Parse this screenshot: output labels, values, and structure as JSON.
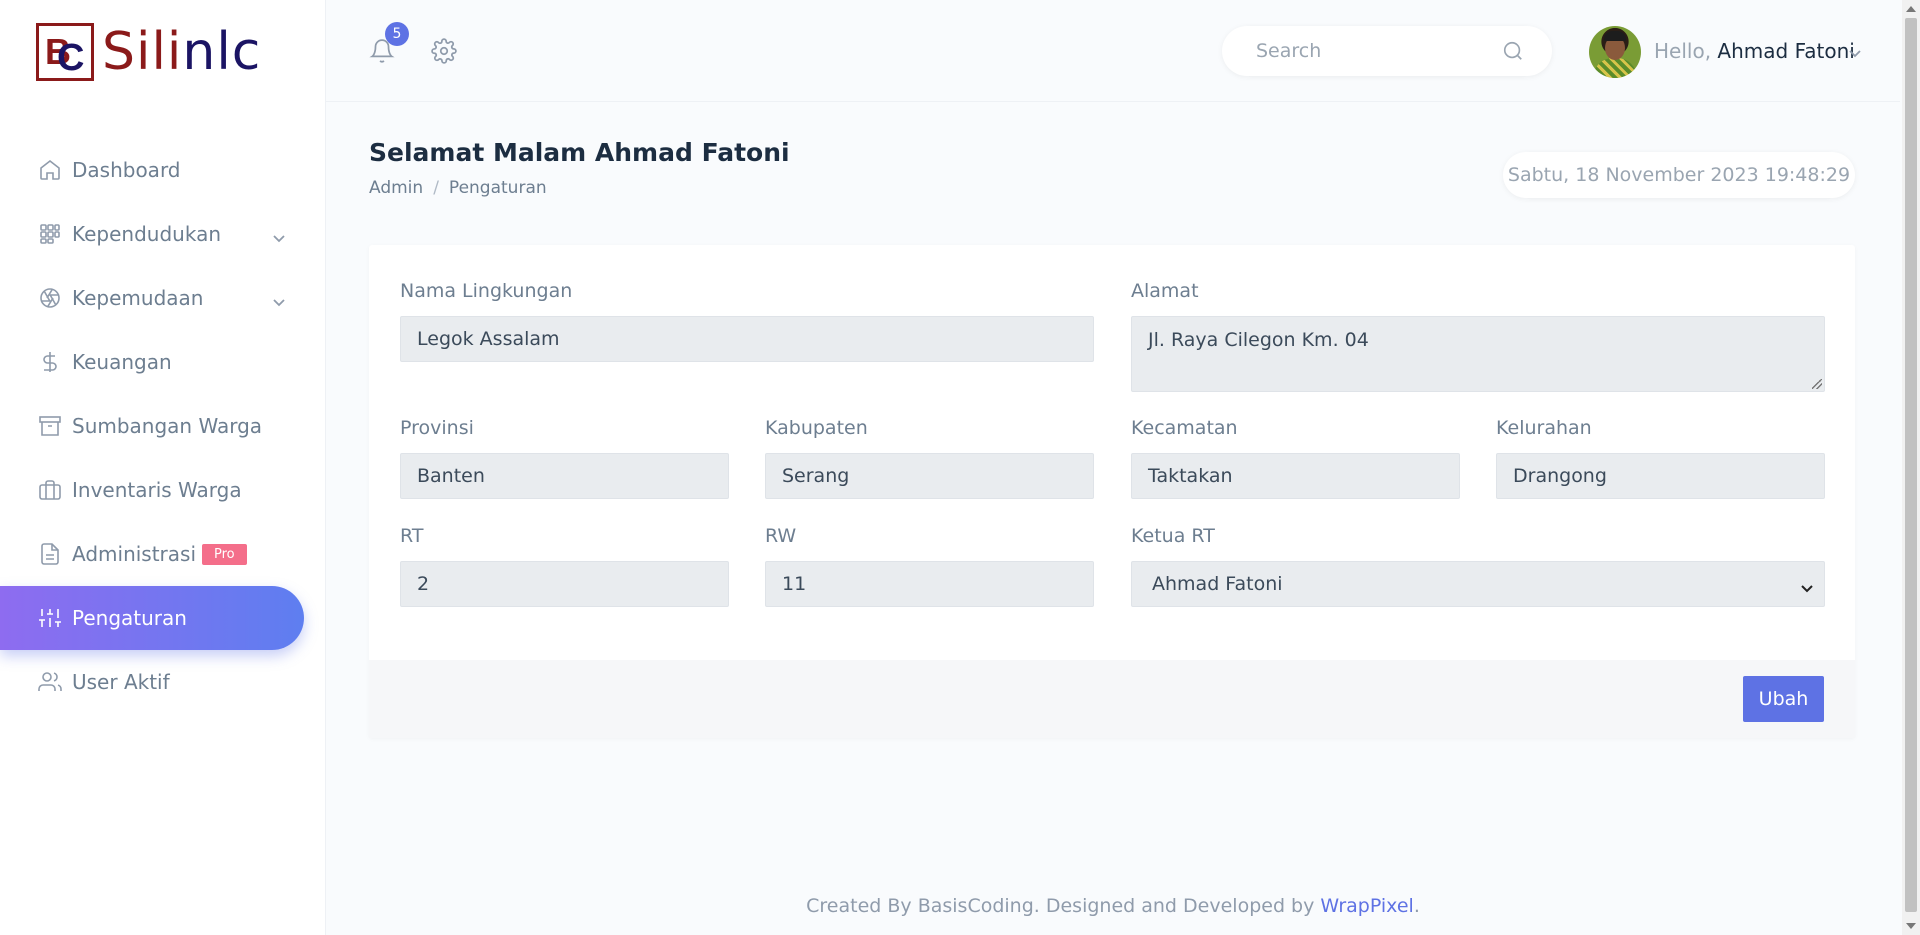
{
  "brand": {
    "logo_text": "Silinlc"
  },
  "sidebar": {
    "items": [
      {
        "label": "Dashboard",
        "icon": "home-icon"
      },
      {
        "label": "Kependudukan",
        "icon": "grid-icon",
        "expandable": true
      },
      {
        "label": "Kepemudaan",
        "icon": "aperture-icon",
        "expandable": true
      },
      {
        "label": "Keuangan",
        "icon": "dollar-icon"
      },
      {
        "label": "Sumbangan Warga",
        "icon": "archive-icon"
      },
      {
        "label": "Inventaris Warga",
        "icon": "briefcase-icon"
      },
      {
        "label": "Administrasi",
        "icon": "file-icon",
        "badge": "Pro"
      },
      {
        "label": "Pengaturan",
        "icon": "sliders-icon",
        "active": true
      },
      {
        "label": "User Aktif",
        "icon": "users-icon"
      }
    ]
  },
  "topbar": {
    "notification_count": "5",
    "search_placeholder": "Search",
    "greeting": "Hello,",
    "user_name": "Ahmad Fatoni"
  },
  "page": {
    "title": "Selamat Malam Ahmad Fatoni",
    "breadcrumb": [
      "Admin",
      "Pengaturan"
    ],
    "datetime": "Sabtu, 18 November 2023 19:48:29"
  },
  "form": {
    "nama_lingkungan": {
      "label": "Nama Lingkungan",
      "value": "Legok Assalam"
    },
    "alamat": {
      "label": "Alamat",
      "value": "Jl. Raya Cilegon Km. 04"
    },
    "provinsi": {
      "label": "Provinsi",
      "value": "Banten"
    },
    "kabupaten": {
      "label": "Kabupaten",
      "value": "Serang"
    },
    "kecamatan": {
      "label": "Kecamatan",
      "value": "Taktakan"
    },
    "kelurahan": {
      "label": "Kelurahan",
      "value": "Drangong"
    },
    "rt": {
      "label": "RT",
      "value": "2"
    },
    "rw": {
      "label": "RW",
      "value": "11"
    },
    "ketua_rt": {
      "label": "Ketua RT",
      "value": "Ahmad Fatoni"
    },
    "submit_label": "Ubah"
  },
  "footer": {
    "text": "Created By BasisCoding. Designed and Developed by",
    "link": "WrapPixel",
    "end": "."
  },
  "colors": {
    "accent": "#5e72e4",
    "active_gradient_start": "#8e6cf0",
    "badge_pro": "#f46e8a"
  }
}
